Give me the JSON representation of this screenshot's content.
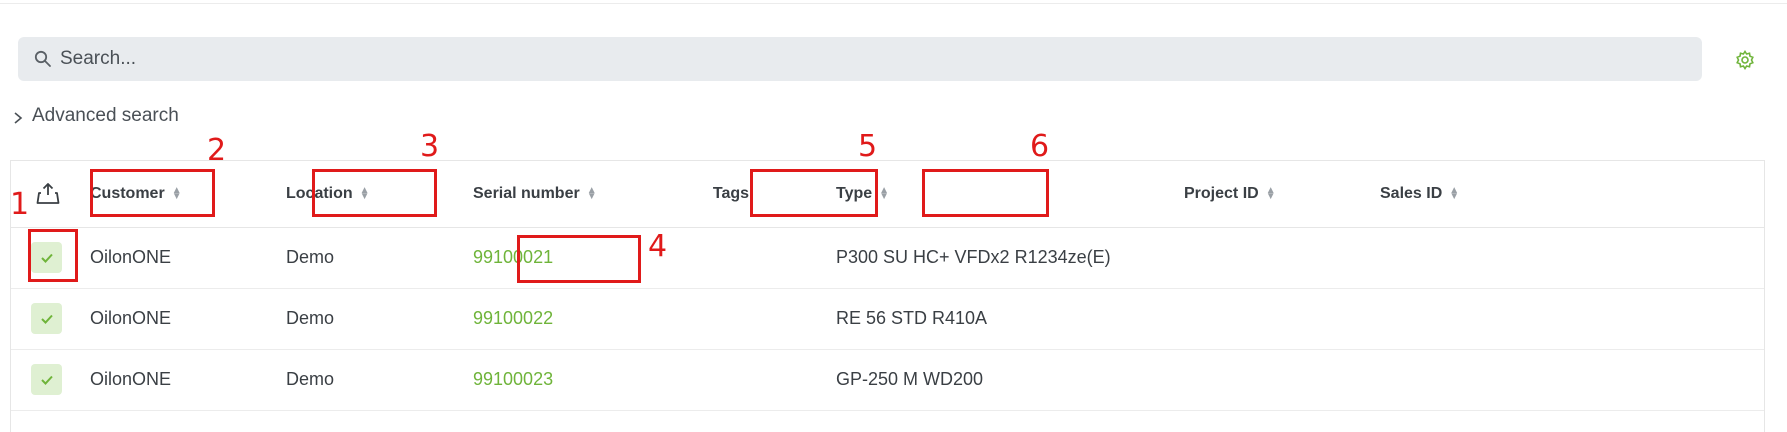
{
  "search": {
    "placeholder": "Search..."
  },
  "advanced_search": {
    "label": "Advanced search"
  },
  "table": {
    "columns": [
      {
        "key": "customer",
        "label": "Customer",
        "sortable": true
      },
      {
        "key": "location",
        "label": "Location",
        "sortable": true
      },
      {
        "key": "serial",
        "label": "Serial number",
        "sortable": true
      },
      {
        "key": "tags",
        "label": "Tags",
        "sortable": false
      },
      {
        "key": "type",
        "label": "Type",
        "sortable": true
      },
      {
        "key": "project_id",
        "label": "Project ID",
        "sortable": true
      },
      {
        "key": "sales_id",
        "label": "Sales ID",
        "sortable": true
      }
    ],
    "rows": [
      {
        "customer": "OilonONE",
        "location": "Demo",
        "serial": "99100021",
        "tags": "",
        "type": "P300 SU HC+ VFDx2 R1234ze(E)",
        "project_id": "",
        "sales_id": ""
      },
      {
        "customer": "OilonONE",
        "location": "Demo",
        "serial": "99100022",
        "tags": "",
        "type": "RE 56 STD R410A",
        "project_id": "",
        "sales_id": ""
      },
      {
        "customer": "OilonONE",
        "location": "Demo",
        "serial": "99100023",
        "tags": "",
        "type": "GP-250 M WD200",
        "project_id": "",
        "sales_id": ""
      }
    ]
  },
  "annotations": [
    "1",
    "2",
    "3",
    "4",
    "5",
    "6"
  ],
  "colors": {
    "accent_green": "#6fb43a",
    "annotation_red": "#e01a1a",
    "search_bg": "#e8ebee"
  }
}
